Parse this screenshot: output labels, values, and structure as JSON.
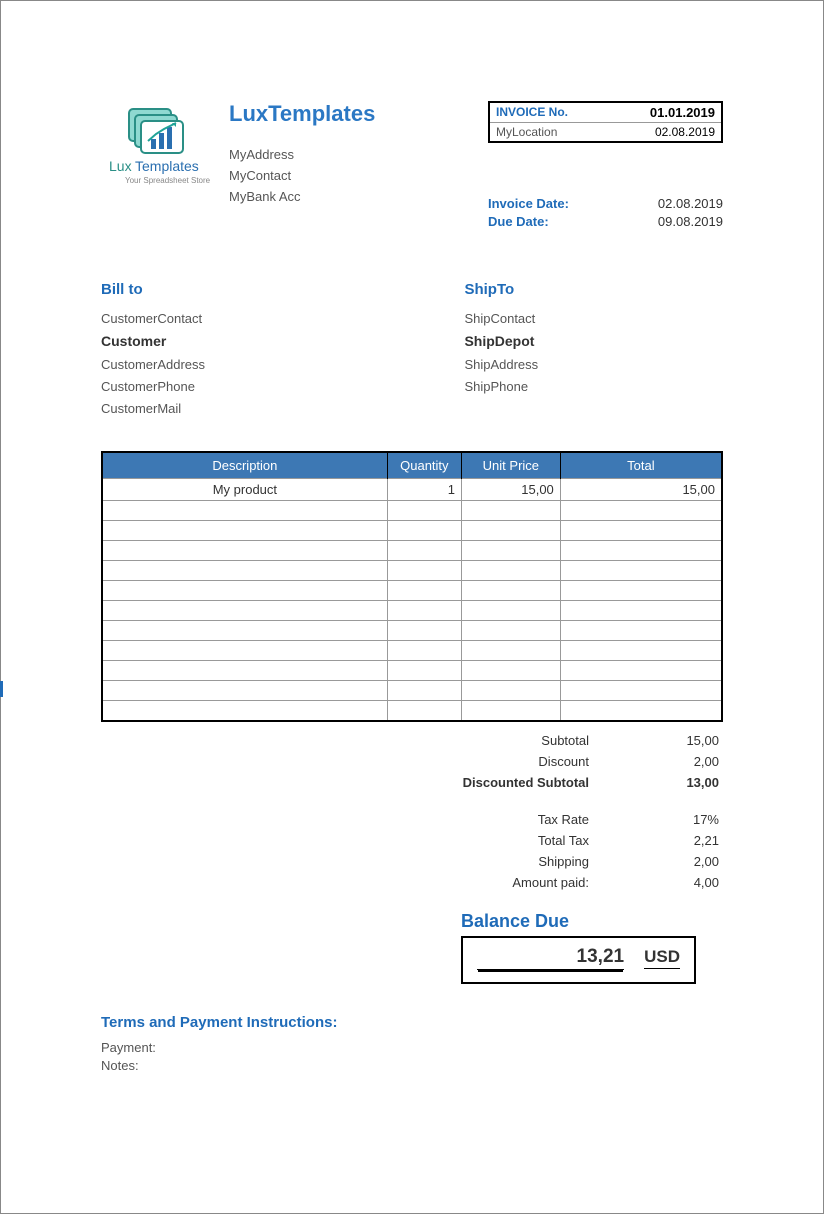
{
  "company": {
    "name": "LuxTemplates",
    "address": "MyAddress",
    "contact": "MyContact",
    "bank": "MyBank Acc",
    "logo_text": "LuxTemplates",
    "logo_tagline": "Your Spreadsheet Store"
  },
  "invoice_box": {
    "no_label": "INVOICE No.",
    "no_value": "01.01.2019",
    "loc_label": "MyLocation",
    "loc_value": "02.08.2019"
  },
  "dates": {
    "invoice_date_label": "Invoice Date:",
    "invoice_date_value": "02.08.2019",
    "due_date_label": "Due Date:",
    "due_date_value": "09.08.2019"
  },
  "bill_to": {
    "heading": "Bill to",
    "contact": "CustomerContact",
    "name": "Customer",
    "address": "CustomerAddress",
    "phone": "CustomerPhone",
    "mail": "CustomerMail"
  },
  "ship_to": {
    "heading": "ShipTo",
    "contact": "ShipContact",
    "name": "ShipDepot",
    "address": "ShipAddress",
    "phone": "ShipPhone"
  },
  "items_header": {
    "description": "Description",
    "quantity": "Quantity",
    "unit_price": "Unit Price",
    "total": "Total"
  },
  "items": [
    {
      "description": "My product",
      "quantity": "1",
      "unit_price": "15,00",
      "total": "15,00"
    },
    {
      "description": "",
      "quantity": "",
      "unit_price": "",
      "total": ""
    },
    {
      "description": "",
      "quantity": "",
      "unit_price": "",
      "total": ""
    },
    {
      "description": "",
      "quantity": "",
      "unit_price": "",
      "total": ""
    },
    {
      "description": "",
      "quantity": "",
      "unit_price": "",
      "total": ""
    },
    {
      "description": "",
      "quantity": "",
      "unit_price": "",
      "total": ""
    },
    {
      "description": "",
      "quantity": "",
      "unit_price": "",
      "total": ""
    },
    {
      "description": "",
      "quantity": "",
      "unit_price": "",
      "total": ""
    },
    {
      "description": "",
      "quantity": "",
      "unit_price": "",
      "total": ""
    },
    {
      "description": "",
      "quantity": "",
      "unit_price": "",
      "total": ""
    },
    {
      "description": "",
      "quantity": "",
      "unit_price": "",
      "total": ""
    },
    {
      "description": "",
      "quantity": "",
      "unit_price": "",
      "total": ""
    }
  ],
  "totals": {
    "subtotal_label": "Subtotal",
    "subtotal_value": "15,00",
    "discount_label": "Discount",
    "discount_value": "2,00",
    "discounted_subtotal_label": "Discounted Subtotal",
    "discounted_subtotal_value": "13,00",
    "tax_rate_label": "Tax Rate",
    "tax_rate_value": "17%",
    "total_tax_label": "Total Tax",
    "total_tax_value": "2,21",
    "shipping_label": "Shipping",
    "shipping_value": "2,00",
    "amount_paid_label": "Amount paid:",
    "amount_paid_value": "4,00"
  },
  "balance": {
    "heading": "Balance Due",
    "amount": "13,21",
    "currency": "USD"
  },
  "terms": {
    "heading": "Terms and Payment Instructions:",
    "payment_label": "Payment:",
    "notes_label": "Notes:"
  }
}
